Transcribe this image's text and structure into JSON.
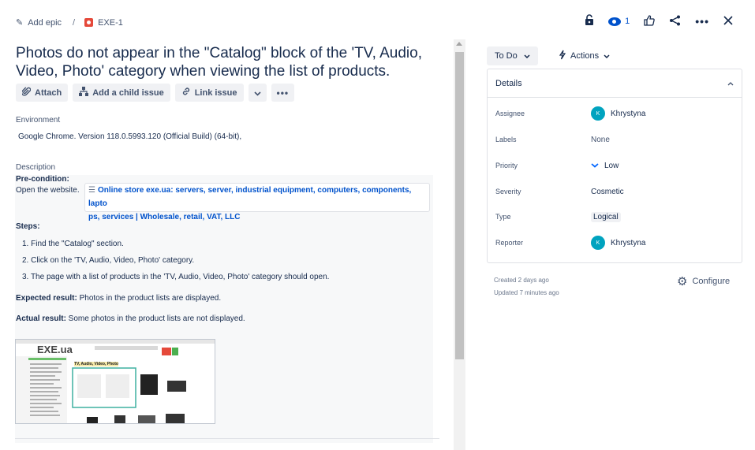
{
  "breadcrumb": {
    "add_epic": "Add epic",
    "separator": "/",
    "issue_key": "EXE-1"
  },
  "topbar": {
    "watch_count": "1"
  },
  "issue": {
    "title": "Photos do not appear in the \"Catalog\" block of the 'TV, Audio, Video, Photo' category when viewing the list of products.",
    "buttons": {
      "attach": "Attach",
      "add_child": "Add a child issue",
      "link_issue": "Link issue"
    },
    "environment_label": "Environment",
    "environment_value": "Google Chrome. Version 118.0.5993.120 (Official Build) (64-bit),",
    "description_label": "Description",
    "precondition_label": "Pre-condition:",
    "open_website": "Open the website.",
    "smart_link_line1": "Online store exe.ua: servers, server, industrial equipment, computers, components, lapto",
    "smart_link_line2": "ps, services | Wholesale, retail, VAT, LLC",
    "steps_label": "Steps:",
    "steps": [
      "1. Find the \"Catalog\" section.",
      "2. Click on the 'TV, Audio, Video, Photo' category.",
      "3. The page with a list of products in the 'TV, Audio, Video, Photo' category should open."
    ],
    "expected_label": "Expected result:",
    "expected_value": " Photos in the product lists are displayed.",
    "actual_label": "Actual result:",
    "actual_value": " Some photos in the product lists are not displayed.",
    "screenshot": {
      "logo": "EXE.ua",
      "heading": "TV, Audio, Video, Photo"
    }
  },
  "sidebar": {
    "status": "To Do",
    "actions": "Actions",
    "details_title": "Details",
    "fields": {
      "assignee_label": "Assignee",
      "assignee_value": "Khrystyna",
      "assignee_initial": "K",
      "labels_label": "Labels",
      "labels_value": "None",
      "priority_label": "Priority",
      "priority_value": "Low",
      "severity_label": "Severity",
      "severity_value": "Cosmetic",
      "type_label": "Type",
      "type_value": "Logical",
      "reporter_label": "Reporter",
      "reporter_value": "Khrystyna",
      "reporter_initial": "K"
    },
    "created": "Created 2 days ago",
    "updated": "Updated 7 minutes ago",
    "configure": "Configure"
  },
  "colors": {
    "link": "#0052cc",
    "bug": "#e5493a",
    "avatar": "#00a3bf",
    "priority_low": "#0065ff"
  },
  "icons": [
    "pencil-icon",
    "bug-icon",
    "lock-icon",
    "eye-icon",
    "thumbs-up-icon",
    "share-icon",
    "more-icon",
    "close-icon",
    "paperclip-icon",
    "child-issue-icon",
    "link-icon",
    "chevron-down-icon",
    "lightning-icon",
    "chevron-up-icon",
    "gear-icon",
    "web-page-icon"
  ]
}
